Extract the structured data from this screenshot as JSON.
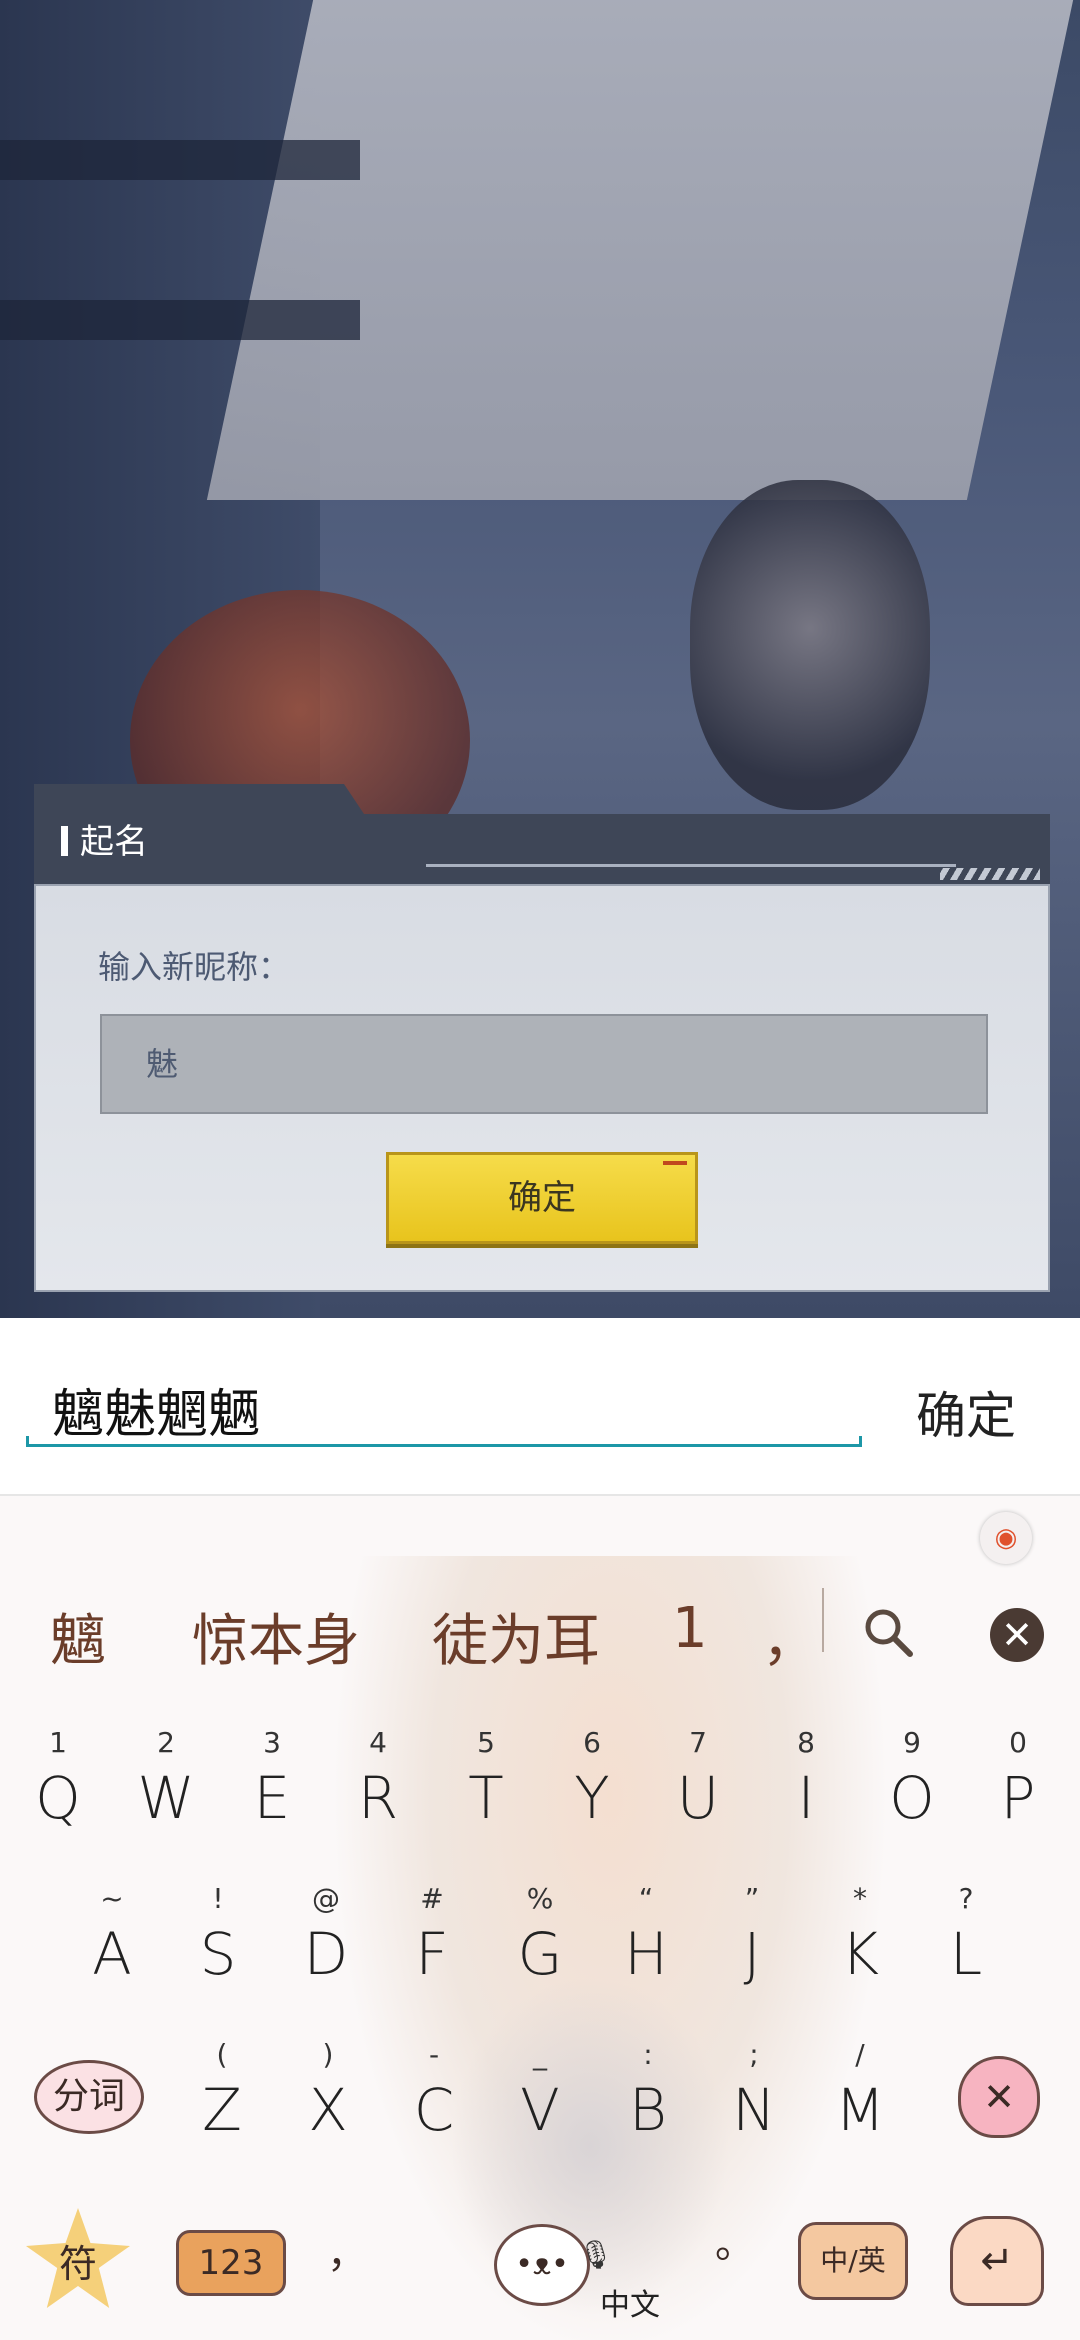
{
  "dialog": {
    "title": "起名",
    "prompt": "输入新昵称：",
    "field_value": "魅",
    "confirm_label": "确定"
  },
  "ime": {
    "composing_text": "魑魅魍魉",
    "confirm_label": "确定"
  },
  "candidates": [
    "魑",
    "惊本身",
    "徒为耳",
    "1",
    "，"
  ],
  "keyboard": {
    "row1": [
      {
        "hint": "1",
        "key": "Q"
      },
      {
        "hint": "2",
        "key": "W"
      },
      {
        "hint": "3",
        "key": "E"
      },
      {
        "hint": "4",
        "key": "R"
      },
      {
        "hint": "5",
        "key": "T"
      },
      {
        "hint": "6",
        "key": "Y"
      },
      {
        "hint": "7",
        "key": "U"
      },
      {
        "hint": "8",
        "key": "I"
      },
      {
        "hint": "9",
        "key": "O"
      },
      {
        "hint": "0",
        "key": "P"
      }
    ],
    "row2": [
      {
        "hint": "~",
        "key": "A"
      },
      {
        "hint": "!",
        "key": "S"
      },
      {
        "hint": "@",
        "key": "D"
      },
      {
        "hint": "#",
        "key": "F"
      },
      {
        "hint": "%",
        "key": "G"
      },
      {
        "hint": "“",
        "key": "H"
      },
      {
        "hint": "”",
        "key": "J"
      },
      {
        "hint": "*",
        "key": "K"
      },
      {
        "hint": "?",
        "key": "L"
      }
    ],
    "row3": [
      {
        "hint": "(",
        "key": "Z"
      },
      {
        "hint": ")",
        "key": "X"
      },
      {
        "hint": "-",
        "key": "C"
      },
      {
        "hint": "_",
        "key": "V"
      },
      {
        "hint": ":",
        "key": "B"
      },
      {
        "hint": ";",
        "key": "N"
      },
      {
        "hint": "/",
        "key": "M"
      }
    ],
    "segment_label": "分词",
    "symbols_label": "符",
    "numbers_label": "123",
    "comma_label": "，",
    "space_label": "中文",
    "period_label": "。",
    "lang_label": "中/英"
  },
  "icons": {
    "delete": "backspace-icon",
    "search": "search-icon",
    "close": "close-circle-icon",
    "enter": "enter-icon",
    "mic": "mic-icon",
    "skin": "skin-badge-icon"
  },
  "colors": {
    "accent": "#1d97a7",
    "confirm_button": "#f0cf32",
    "candidate_text": "#6b3d2a"
  }
}
